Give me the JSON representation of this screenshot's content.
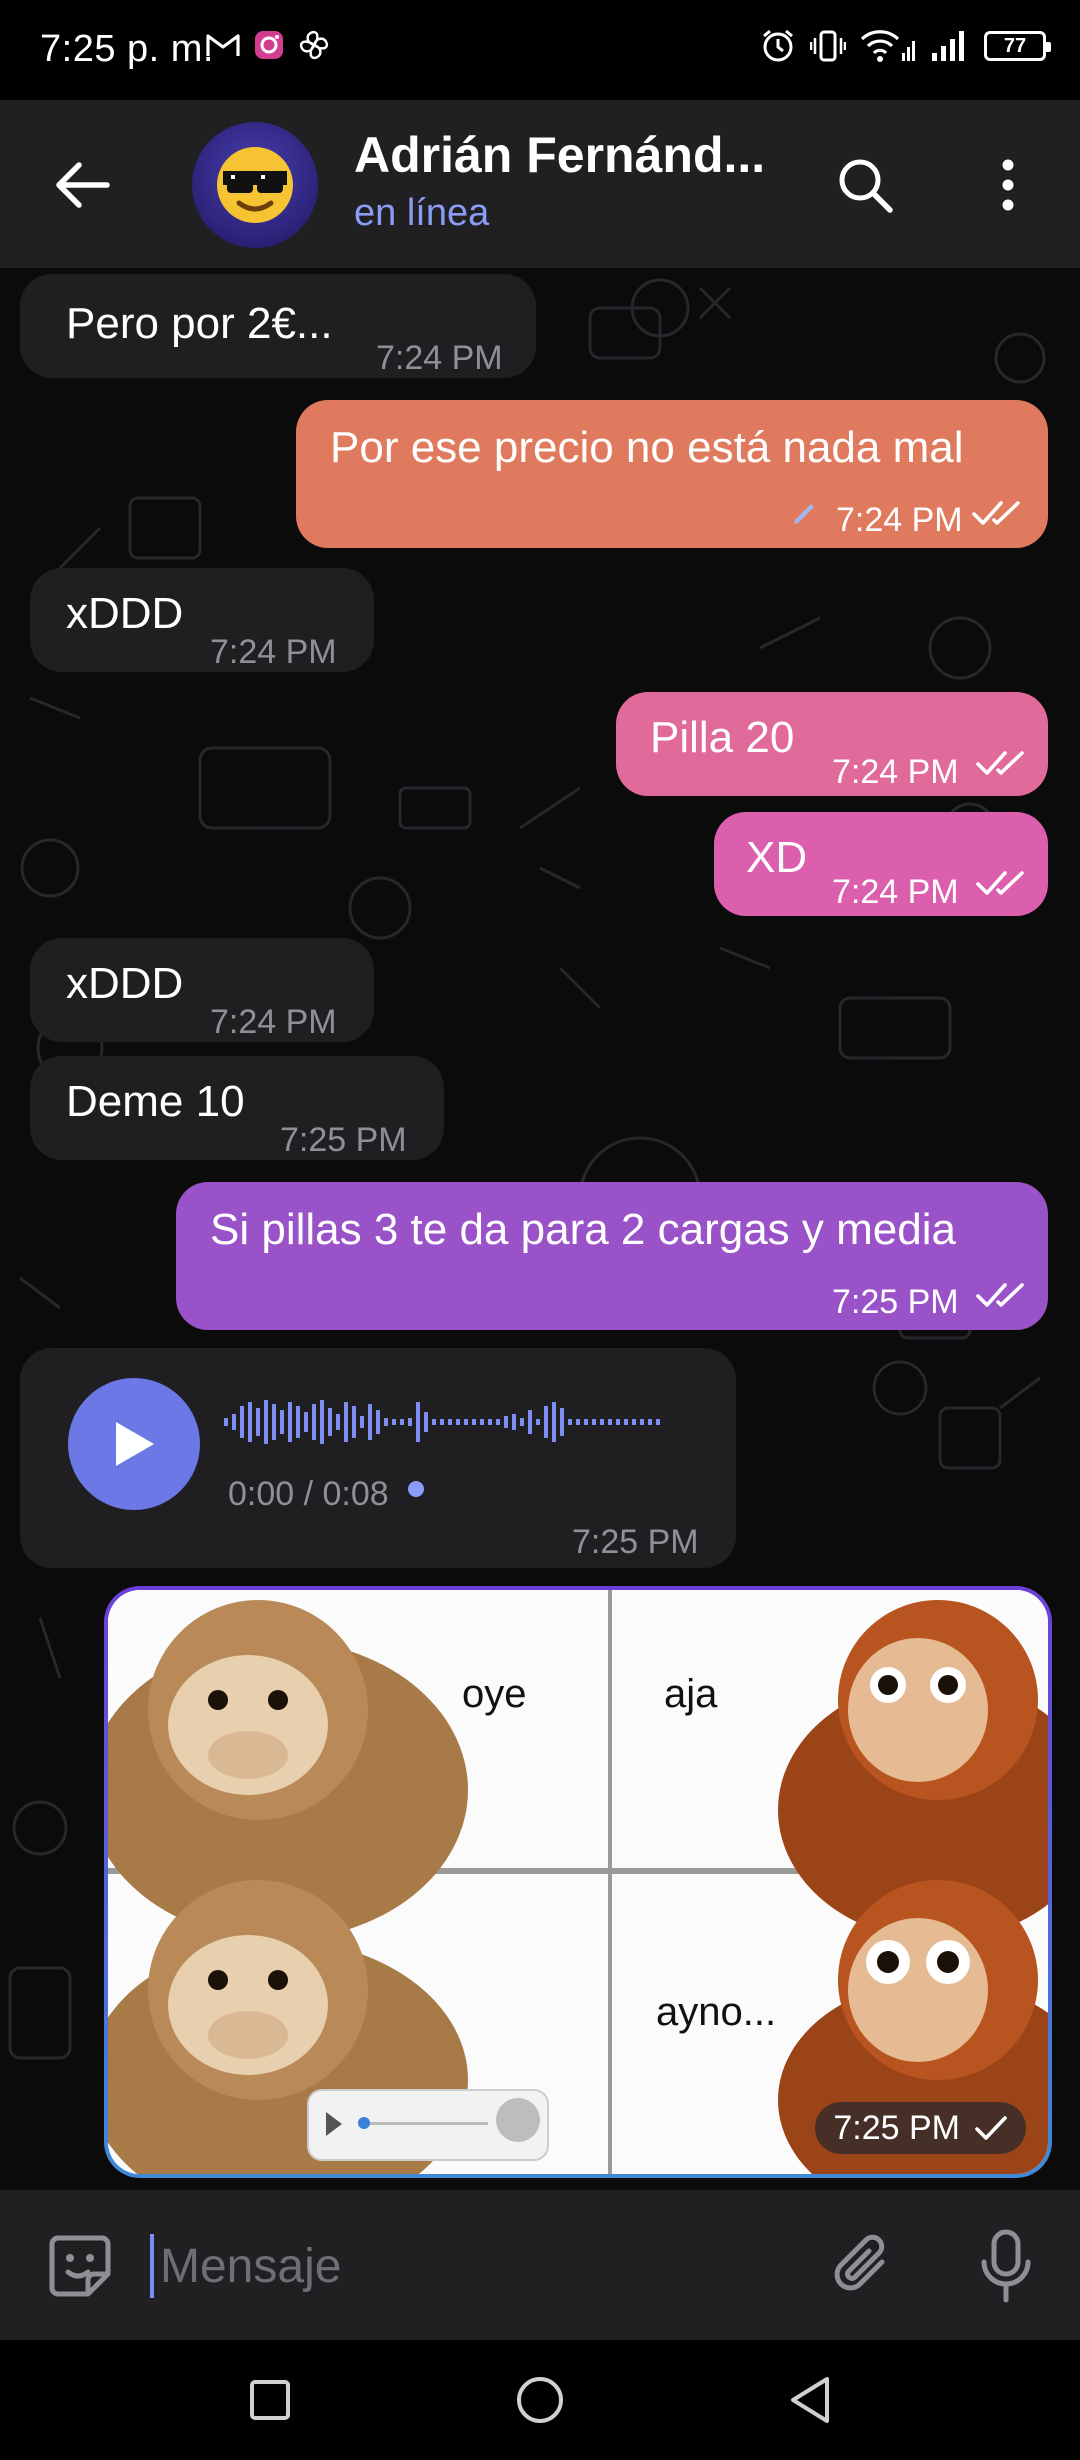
{
  "status_bar": {
    "time": "7:25 p. m.",
    "battery": "77",
    "left_icons": [
      "gmail-icon",
      "instagram-icon",
      "pinwheel-icon"
    ],
    "right_icons": [
      "alarm-icon",
      "vibrate-icon",
      "wifi-icon",
      "signal-icon",
      "signal-icon",
      "battery-icon"
    ]
  },
  "header": {
    "name": "Adrián Fernánd...",
    "status": "en línea",
    "avatar_emoji": "😎"
  },
  "messages": [
    {
      "dir": "in",
      "text": "Pero por 2€...",
      "time": "7:24 PM"
    },
    {
      "dir": "out",
      "text": "Por ese precio no está nada mal",
      "time": "7:24 PM",
      "edited": true,
      "read": true
    },
    {
      "dir": "in",
      "text": "xDDD",
      "time": "7:24 PM"
    },
    {
      "dir": "out",
      "text": "Pilla 20",
      "time": "7:24 PM",
      "read": true
    },
    {
      "dir": "out",
      "text": "XD",
      "time": "7:24 PM",
      "read": true
    },
    {
      "dir": "in",
      "text": "xDDD",
      "time": "7:24 PM"
    },
    {
      "dir": "in",
      "text": "Deme 10",
      "time": "7:25 PM"
    },
    {
      "dir": "out",
      "text": "Si pillas 3 te da para 2 cargas y media",
      "time": "7:25 PM",
      "read": true
    }
  ],
  "voice_message": {
    "duration": "0:00 / 0:08",
    "time": "7:25 PM"
  },
  "meme": {
    "panels": [
      "oye",
      "aja",
      "",
      "ayno..."
    ],
    "time": "7:25 PM"
  },
  "input": {
    "placeholder": "Mensaje"
  },
  "colors": {
    "accent": "#8a9cf5",
    "header_bg": "#202022",
    "incoming_bubble": "#1f1f22",
    "outgoing_orange": "#e07a5e",
    "outgoing_pink": "#de5fa0",
    "outgoing_purple": "#9a52c8"
  }
}
